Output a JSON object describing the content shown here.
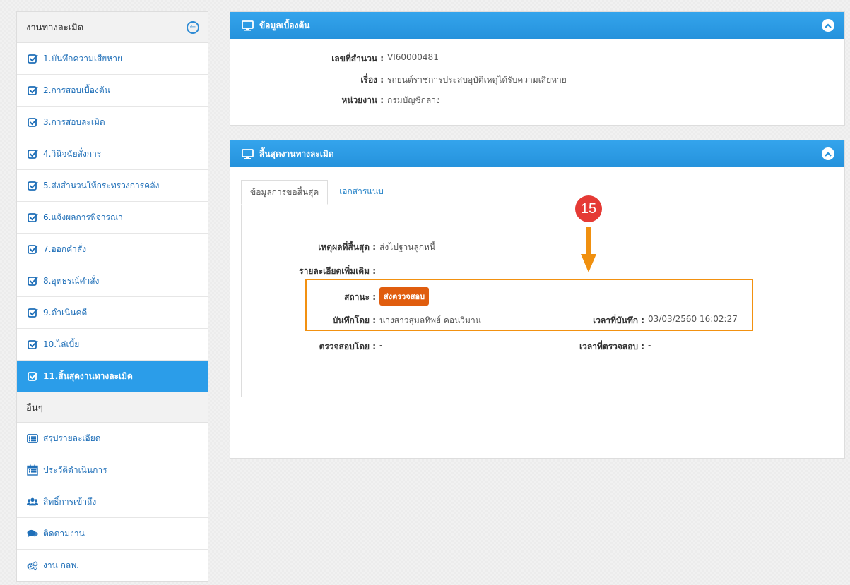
{
  "sidebar": {
    "header": "งานทางละเมิด",
    "items": [
      {
        "label": "1.บันทึกความเสียหาย"
      },
      {
        "label": "2.การสอบเบื้องต้น"
      },
      {
        "label": "3.การสอบละเมิด"
      },
      {
        "label": "4.วินิจฉัยสั่งการ"
      },
      {
        "label": "5.ส่งสำนวนให้กระทรวงการคลัง"
      },
      {
        "label": "6.แจ้งผลการพิจารณา"
      },
      {
        "label": "7.ออกคำสั่ง"
      },
      {
        "label": "8.อุทธรณ์คำสั่ง"
      },
      {
        "label": "9.ดำเนินคดี"
      },
      {
        "label": "10.ไล่เบี้ย"
      },
      {
        "label": "11.สิ้นสุดงานทางละเมิด"
      }
    ],
    "other_header": "อื่นๆ",
    "other_items": [
      {
        "label": "สรุปรายละเอียด",
        "icon": "list-icon"
      },
      {
        "label": "ประวัติดำเนินการ",
        "icon": "calendar-icon"
      },
      {
        "label": "สิทธิ์การเข้าถึง",
        "icon": "users-icon"
      },
      {
        "label": "ติดตามงาน",
        "icon": "comments-icon"
      },
      {
        "label": "งาน กลพ.",
        "icon": "cogs-icon"
      }
    ]
  },
  "basic_panel": {
    "title": "ข้อมูลเบื้องต้น",
    "case_no_label": "เลขที่สำนวน :",
    "case_no": "VI60000481",
    "subject_label": "เรื่อง :",
    "subject": "รถยนต์ราชการประสบอุบัติเหตุได้รับความเสียหาย",
    "agency_label": "หน่วยงาน :",
    "agency": "กรมบัญชีกลาง"
  },
  "end_panel": {
    "title": "สิ้นสุดงานทางละเมิด",
    "tabs": [
      "ข้อมูลการขอสิ้นสุด",
      "เอกสารแนบ"
    ],
    "reason_label": "เหตุผลที่สิ้นสุด :",
    "reason": "ส่งไปฐานลูกหนี้",
    "detail_label": "รายละเอียดเพิ่มเติม :",
    "detail": "-",
    "status_label": "สถานะ :",
    "status": "ส่งตรวจสอบ",
    "recorded_by_label": "บันทึกโดย :",
    "recorded_by": "นางสาวสุมลทิพย์ คอนวิมาน",
    "recorded_time_label": "เวลาที่บันทึก :",
    "recorded_time": "03/03/2560 16:02:27",
    "checked_by_label": "ตรวจสอบโดย :",
    "checked_by": "-",
    "checked_time_label": "เวลาที่ตรวจสอบ :",
    "checked_time": "-"
  },
  "annotation": {
    "step": "15",
    "color": "#f0900f"
  },
  "colors": {
    "accent": "#2b9de9",
    "badge": "#e05d0e",
    "link": "#1f6fb8"
  }
}
